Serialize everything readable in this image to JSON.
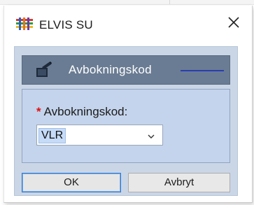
{
  "window": {
    "title": "ELVIS SU",
    "app_icon": "elvis-app-icon",
    "close_icon": "close-icon"
  },
  "section": {
    "title": "Avbokningskod",
    "icon": "document-edit-icon"
  },
  "form": {
    "field": {
      "required_marker": "*",
      "label": "Avbokningskod:",
      "selected_value": "VLR",
      "chevron_icon": "chevron-down-icon"
    }
  },
  "buttons": {
    "ok_label": "OK",
    "cancel_label": "Avbryt"
  },
  "colors": {
    "client_bg": "#cad6e6",
    "header_bg": "#6a7c93",
    "panel_bg": "#c4d4ec",
    "required": "#e01010",
    "accent_line": "#2a3eb0"
  }
}
